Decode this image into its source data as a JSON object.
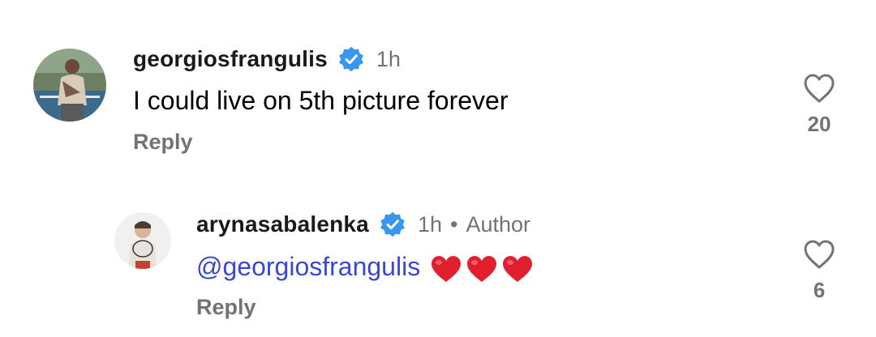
{
  "comments": [
    {
      "username": "georgiosfrangulis",
      "verified": true,
      "time": "1h",
      "text": "I could live on 5th picture forever",
      "reply_label": "Reply",
      "like_count": "20",
      "avatar_icon": "user-avatar"
    },
    {
      "username": "arynasabalenka",
      "verified": true,
      "time": "1h",
      "separator": "•",
      "author_label": "Author",
      "mention": "@georgiosfrangulis",
      "emoji": [
        "red-heart",
        "red-heart",
        "red-heart"
      ],
      "reply_label": "Reply",
      "like_count": "6",
      "avatar_icon": "user-avatar"
    }
  ],
  "colors": {
    "verified_badge": "#3797f0",
    "mention": "#3b48d6",
    "secondary_text": "#737373",
    "heart_emoji": "#e0202f"
  }
}
